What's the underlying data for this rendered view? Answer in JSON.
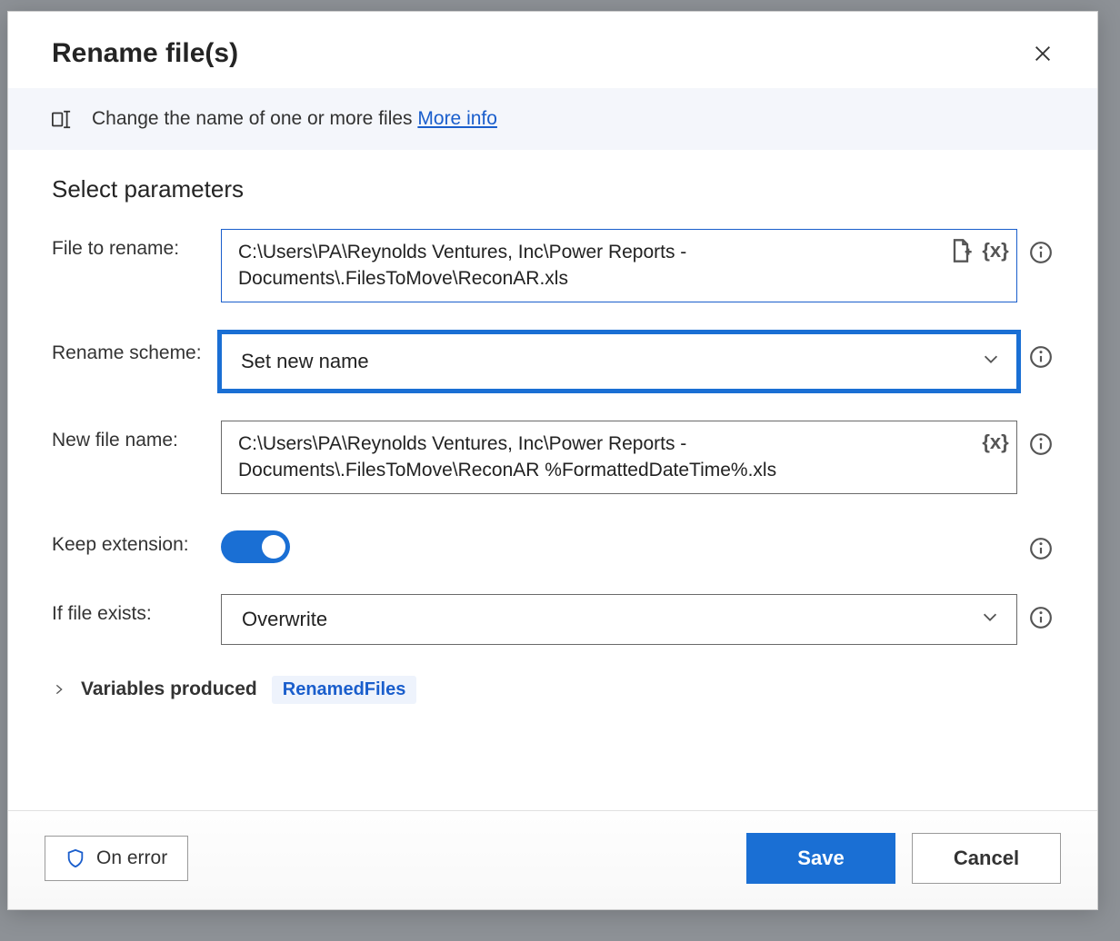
{
  "dialog": {
    "title": "Rename file(s)",
    "description": "Change the name of one or more files",
    "more_info_label": "More info"
  },
  "section_heading": "Select parameters",
  "params": {
    "file_to_rename": {
      "label": "File to rename:",
      "value": "C:\\Users\\PA\\Reynolds Ventures, Inc\\Power Reports - Documents\\.FilesToMove\\ReconAR.xls"
    },
    "rename_scheme": {
      "label": "Rename scheme:",
      "value": "Set new name"
    },
    "new_file_name": {
      "label": "New file name:",
      "value": "C:\\Users\\PA\\Reynolds Ventures, Inc\\Power Reports - Documents\\.FilesToMove\\ReconAR %FormattedDateTime%.xls"
    },
    "keep_extension": {
      "label": "Keep extension:",
      "on": true
    },
    "if_file_exists": {
      "label": "If file exists:",
      "value": "Overwrite"
    }
  },
  "variables_produced": {
    "label": "Variables produced",
    "items": [
      "RenamedFiles"
    ]
  },
  "footer": {
    "on_error": "On error",
    "save": "Save",
    "cancel": "Cancel"
  },
  "glyphs": {
    "var_x": "{x}"
  }
}
